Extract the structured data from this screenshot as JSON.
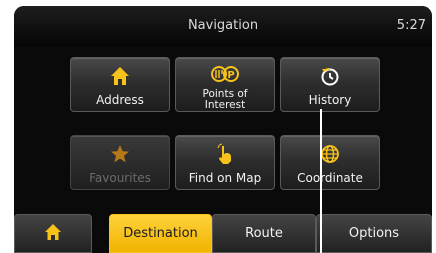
{
  "header": {
    "title": "Navigation",
    "time": "5:27"
  },
  "menu": {
    "address": "Address",
    "poi_line1": "Points of",
    "poi_line2": "Interest",
    "history": "History",
    "favourites": "Favourites",
    "find_on_map": "Find on Map",
    "coordinate": "Coordinate"
  },
  "tabs": {
    "home_icon": "home-icon",
    "destination": "Destination",
    "route": "Route",
    "options": "Options",
    "active": "Destination"
  },
  "colors": {
    "accent": "#f7c21a",
    "icon": "#f7c21a",
    "disabled_text": "#6b6b6b"
  }
}
